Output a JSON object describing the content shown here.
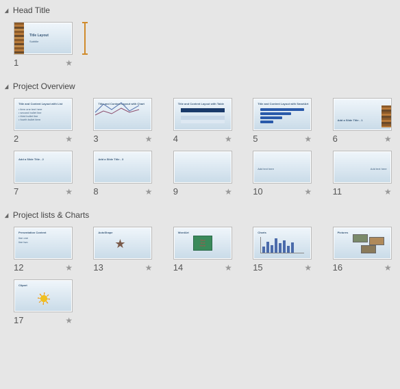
{
  "sections": [
    {
      "title": "Head Title",
      "slides": [
        {
          "num": "1",
          "type": "title",
          "text": "Title Layout",
          "subtitle": "Subtitle",
          "indicator": true
        }
      ]
    },
    {
      "title": "Project Overview",
      "slides": [
        {
          "num": "2",
          "type": "list",
          "text": "Title and Content Layout with List"
        },
        {
          "num": "3",
          "type": "linechart",
          "text": "Title and Content Layout with Chart"
        },
        {
          "num": "4",
          "type": "table",
          "text": "Title and Content Layout with Table"
        },
        {
          "num": "5",
          "type": "smartart",
          "text": "Title and Content Layout with SmartArt"
        },
        {
          "num": "6",
          "type": "booksright",
          "text": "Add a Slide Title - 1"
        },
        {
          "num": "7",
          "type": "plain",
          "text": "Add a Slide Title - 2"
        },
        {
          "num": "8",
          "type": "plain",
          "text": "Add a Slide Title - 3"
        },
        {
          "num": "9",
          "type": "blank",
          "text": ""
        },
        {
          "num": "10",
          "type": "smallleft",
          "text": ""
        },
        {
          "num": "11",
          "type": "smallright",
          "text": ""
        }
      ]
    },
    {
      "title": "Project lists & Charts",
      "slides": [
        {
          "num": "12",
          "type": "list2",
          "text": "Presentation Content"
        },
        {
          "num": "13",
          "type": "starshape",
          "text": "AutoShape"
        },
        {
          "num": "14",
          "type": "greenbox",
          "text": "WordArt"
        },
        {
          "num": "15",
          "type": "barchart",
          "text": "Charts"
        },
        {
          "num": "16",
          "type": "pictures",
          "text": "Pictures"
        },
        {
          "num": "17",
          "type": "sun",
          "text": "Clipart"
        }
      ]
    }
  ],
  "icons": {
    "collapse": "◢",
    "star": "★"
  }
}
